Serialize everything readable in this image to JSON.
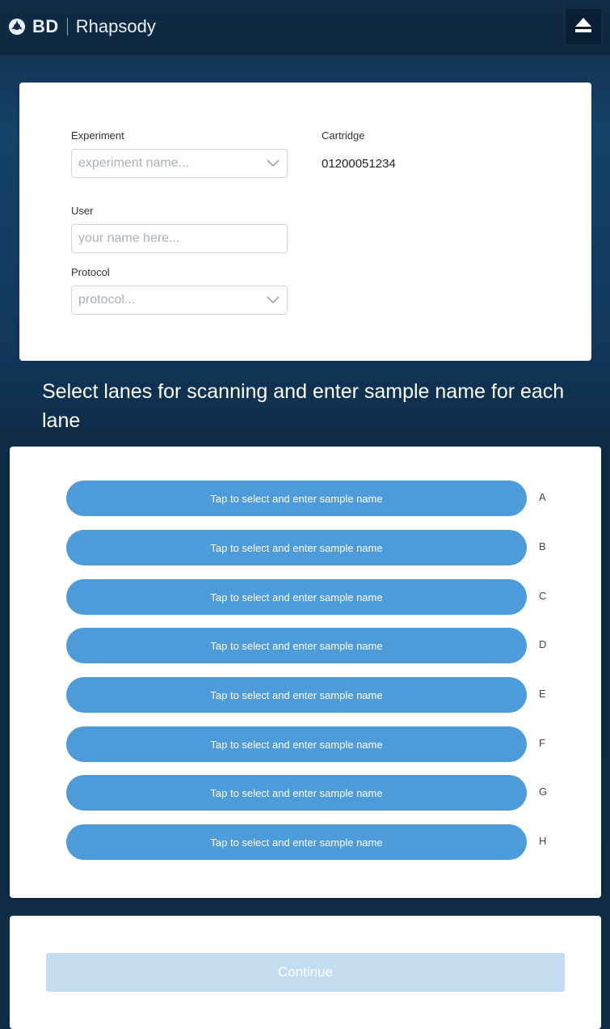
{
  "header": {
    "brand": "BD",
    "product": "Rhapsody",
    "eject_icon": "eject-icon"
  },
  "form": {
    "experiment": {
      "label": "Experiment",
      "placeholder": "experiment name..."
    },
    "cartridge": {
      "label": "Cartridge",
      "value": "01200051234"
    },
    "user": {
      "label": "User",
      "placeholder": "your name here..."
    },
    "protocol": {
      "label": "Protocol",
      "placeholder": "protocol..."
    }
  },
  "section": {
    "heading": "Select lanes for scanning and enter sample name for each lane"
  },
  "lanes": [
    {
      "letter": "A",
      "button_label": "Tap to select and enter sample name"
    },
    {
      "letter": "B",
      "button_label": "Tap to select and enter sample name"
    },
    {
      "letter": "C",
      "button_label": "Tap to select and enter sample name"
    },
    {
      "letter": "D",
      "button_label": "Tap to select and enter sample name"
    },
    {
      "letter": "E",
      "button_label": "Tap to select and enter sample name"
    },
    {
      "letter": "F",
      "button_label": "Tap to select and enter sample name"
    },
    {
      "letter": "G",
      "button_label": "Tap to select and enter sample name"
    },
    {
      "letter": "H",
      "button_label": "Tap to select and enter sample name"
    }
  ],
  "footer": {
    "continue_label": "Continue",
    "continue_enabled": false
  },
  "colors": {
    "header_bg": "#0e2840",
    "page_bg": "#15426a",
    "lane_button": "#4d9bd9",
    "continue_disabled": "#c4dcef"
  }
}
